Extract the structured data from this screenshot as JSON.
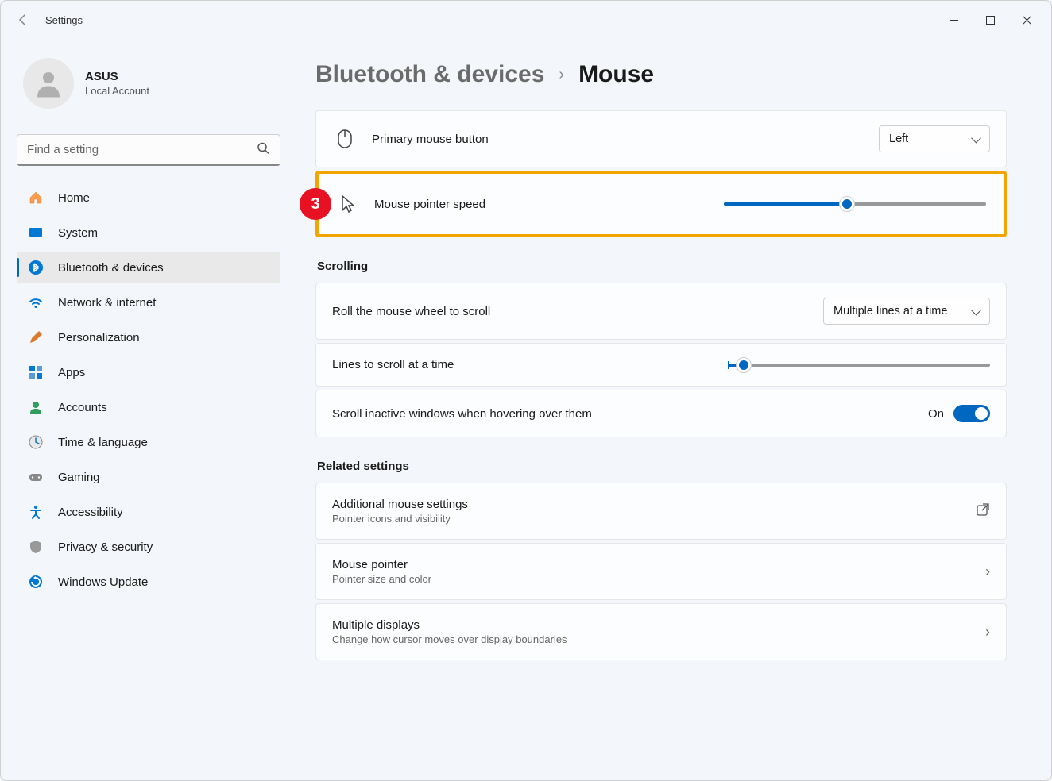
{
  "window": {
    "title": "Settings"
  },
  "profile": {
    "name": "ASUS",
    "account": "Local Account"
  },
  "search": {
    "placeholder": "Find a setting"
  },
  "nav": {
    "items": [
      {
        "label": "Home"
      },
      {
        "label": "System"
      },
      {
        "label": "Bluetooth & devices"
      },
      {
        "label": "Network & internet"
      },
      {
        "label": "Personalization"
      },
      {
        "label": "Apps"
      },
      {
        "label": "Accounts"
      },
      {
        "label": "Time & language"
      },
      {
        "label": "Gaming"
      },
      {
        "label": "Accessibility"
      },
      {
        "label": "Privacy & security"
      },
      {
        "label": "Windows Update"
      }
    ],
    "active_index": 2
  },
  "breadcrumb": {
    "parent": "Bluetooth & devices",
    "current": "Mouse"
  },
  "settings": {
    "primary_button": {
      "label": "Primary mouse button",
      "value": "Left"
    },
    "pointer_speed": {
      "label": "Mouse pointer speed",
      "percent": 47
    },
    "scrolling_header": "Scrolling",
    "scroll_mode": {
      "label": "Roll the mouse wheel to scroll",
      "value": "Multiple lines at a time"
    },
    "lines_at_time": {
      "label": "Lines to scroll at a time",
      "percent": 6
    },
    "inactive_scroll": {
      "label": "Scroll inactive windows when hovering over them",
      "state": "On"
    },
    "related_header": "Related settings",
    "additional": {
      "title": "Additional mouse settings",
      "sub": "Pointer icons and visibility"
    },
    "pointer": {
      "title": "Mouse pointer",
      "sub": "Pointer size and color"
    },
    "displays": {
      "title": "Multiple displays",
      "sub": "Change how cursor moves over display boundaries"
    }
  },
  "annotation": {
    "badge": "3"
  }
}
